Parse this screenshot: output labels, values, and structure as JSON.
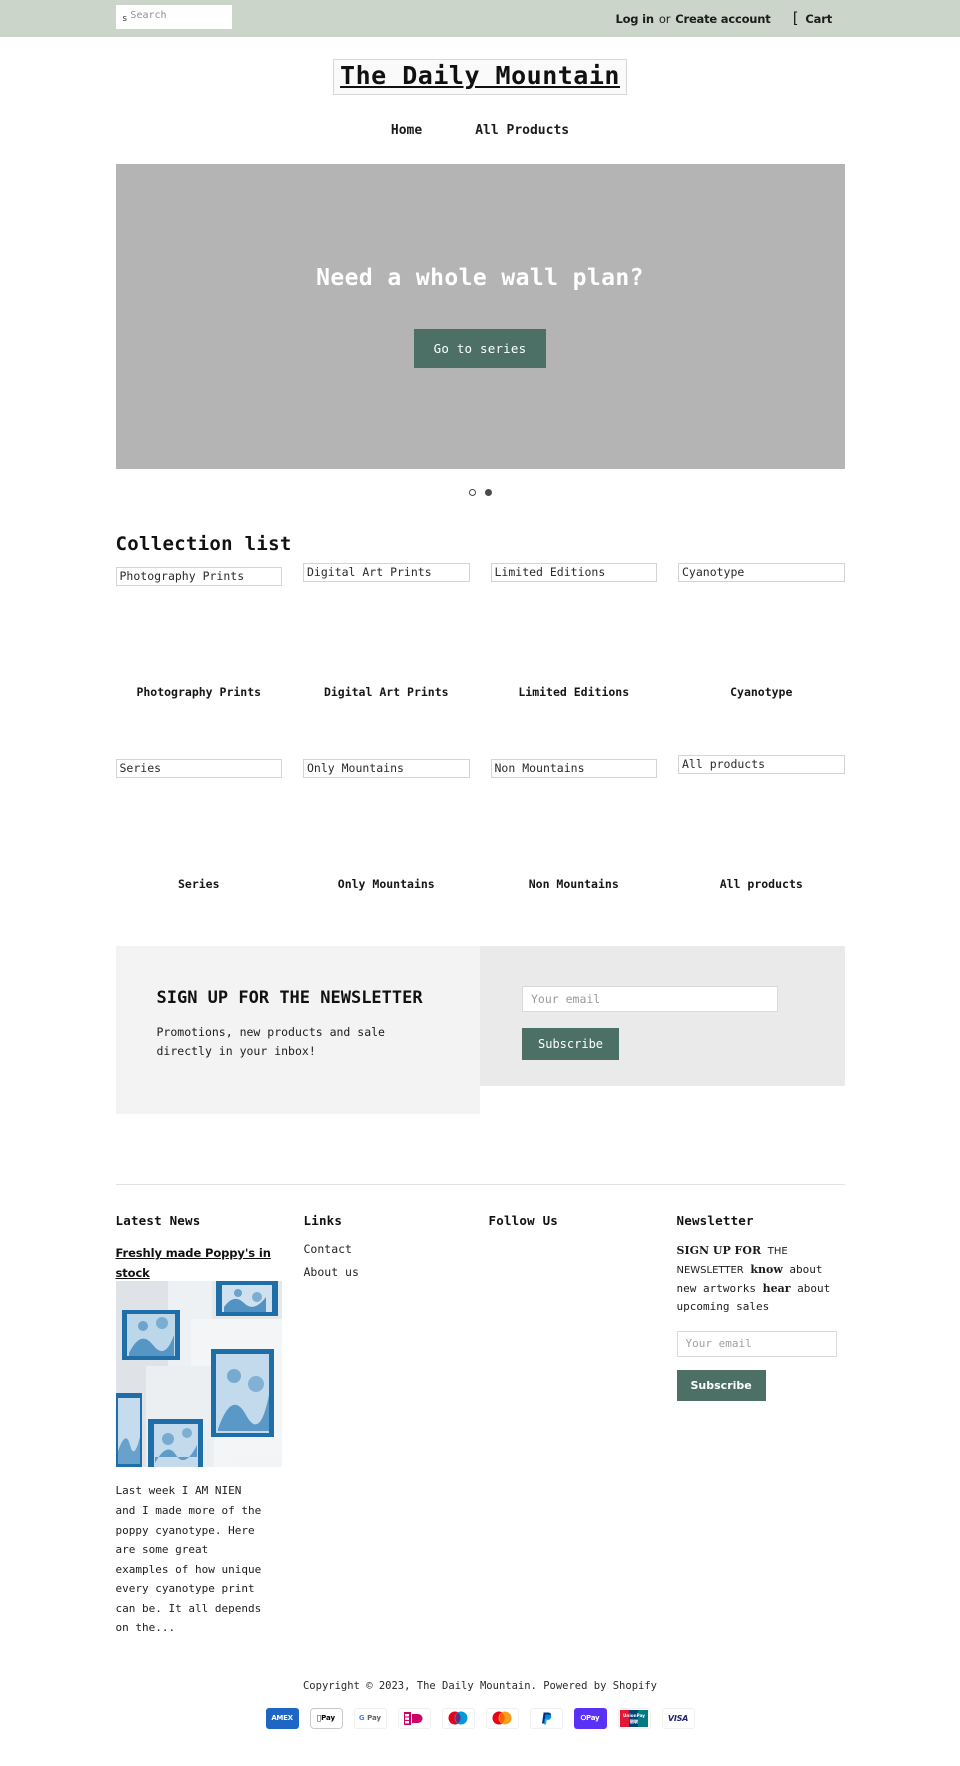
{
  "topbar": {
    "search": {
      "placeholder": "Search",
      "value": "",
      "icon": "search-icon",
      "icon_glyph": "s"
    },
    "login_label": "Log in",
    "or_label": "or",
    "create_account_label": "Create account",
    "cart_label": "Cart",
    "cart_icon_glyph": "[",
    "bg_color": "#ccd5c9"
  },
  "header": {
    "logo": "The Daily Mountain",
    "nav": [
      {
        "label": "Home"
      },
      {
        "label": "All Products"
      }
    ]
  },
  "hero": {
    "title": "Need a whole wall plan?",
    "button_label": "Go to series",
    "button_color": "#4d7066",
    "placeholder_color": "#b4b4b4",
    "slides": [
      {
        "index": 1,
        "active": false
      },
      {
        "index": 2,
        "active": true
      }
    ]
  },
  "collections": {
    "heading": "Collection list",
    "row1": [
      {
        "alt": "Photography Prints",
        "caption": "Photography Prints"
      },
      {
        "alt": "Digital Art Prints",
        "caption": "Digital Art Prints"
      },
      {
        "alt": "Limited Editions",
        "caption": "Limited Editions"
      },
      {
        "alt": "Cyanotype",
        "caption": "Cyanotype"
      }
    ],
    "row2": [
      {
        "alt": "Series",
        "caption": "Series"
      },
      {
        "alt": "Only Mountains",
        "caption": "Only Mountains"
      },
      {
        "alt": "Non Mountains",
        "caption": "Non Mountains"
      },
      {
        "alt": "All products",
        "caption": "All products"
      }
    ]
  },
  "promo": {
    "title": "SIGN UP FOR THE NEWSLETTER",
    "subtitle": "Promotions, new products and sale directly in your inbox!",
    "email_placeholder": "Your email",
    "email_value": "",
    "subscribe_label": "Subscribe"
  },
  "footer": {
    "latest_news": {
      "heading": "Latest News",
      "article_title": "Freshly made Poppy's in stock",
      "excerpt": "Last week I AM NIEN and I made more of the poppy cyanotype. Here are some great examples of how unique every cyanotype print can be. It all depends on the..."
    },
    "links": {
      "heading": "Links",
      "items": [
        {
          "label": "Contact"
        },
        {
          "label": "About us"
        }
      ]
    },
    "follow": {
      "heading": "Follow Us"
    },
    "newsletter": {
      "heading": "Newsletter",
      "body_part1": "SIGN UP FOR",
      "body_part2": "THE NEWSLETTER",
      "body_part3": "know",
      "body_part4": "about new artworks",
      "body_part5": "hear",
      "body_part6": "about upcoming sales",
      "email_placeholder": "Your email",
      "email_value": "",
      "subscribe_label": "Subscribe"
    }
  },
  "copyright": {
    "text": "Copyright © 2023, The Daily Mountain. Powered by Shopify"
  },
  "payments": [
    {
      "name": "amex",
      "label": "AMEX"
    },
    {
      "name": "apple-pay",
      "label": "Pay"
    },
    {
      "name": "google-pay",
      "label": "Pay"
    },
    {
      "name": "ideal",
      "label": "iD"
    },
    {
      "name": "maestro",
      "label": ""
    },
    {
      "name": "mastercard",
      "label": ""
    },
    {
      "name": "paypal",
      "label": "P"
    },
    {
      "name": "shop-pay",
      "label": "Pay"
    },
    {
      "name": "unionpay",
      "label": "UnionPay"
    },
    {
      "name": "visa",
      "label": "VISA"
    }
  ]
}
